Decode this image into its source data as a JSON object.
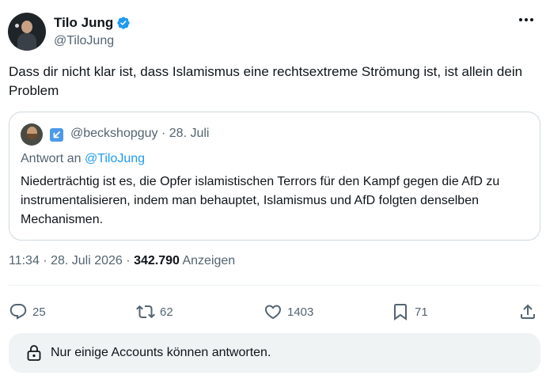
{
  "author": {
    "display_name": "Tilo Jung",
    "handle": "@TiloJung",
    "verified_icon": "verified-badge-icon"
  },
  "tweet": {
    "text": "Dass dir nicht klar ist, dass Islamismus eine rechtsextreme Strömung ist, ist allein dein Problem"
  },
  "quote": {
    "handle": "@beckshopguy",
    "separator": "·",
    "date": "28. Juli",
    "reply_prefix": "Antwort an",
    "reply_mention": "@TiloJung",
    "text": "Niederträchtig ist es, die Opfer islamistischen Terrors für den Kampf gegen die AfD zu instrumentalisieren, indem man behauptet, Islamismus und AfD folgten denselben Mechanismen."
  },
  "meta": {
    "time": "11:34",
    "separator": "·",
    "date": "28. Juli 2026",
    "separator2": "·",
    "views": "342.790",
    "views_label": "Anzeigen"
  },
  "actions": {
    "replies": "25",
    "reposts": "62",
    "likes": "1403",
    "bookmarks": "71"
  },
  "reply_restriction": {
    "text": "Nur einige Accounts können antworten."
  },
  "colors": {
    "accent": "#1d9bf0",
    "secondary_text": "#536471",
    "primary_text": "#0f1419",
    "border": "#cfd9de"
  }
}
